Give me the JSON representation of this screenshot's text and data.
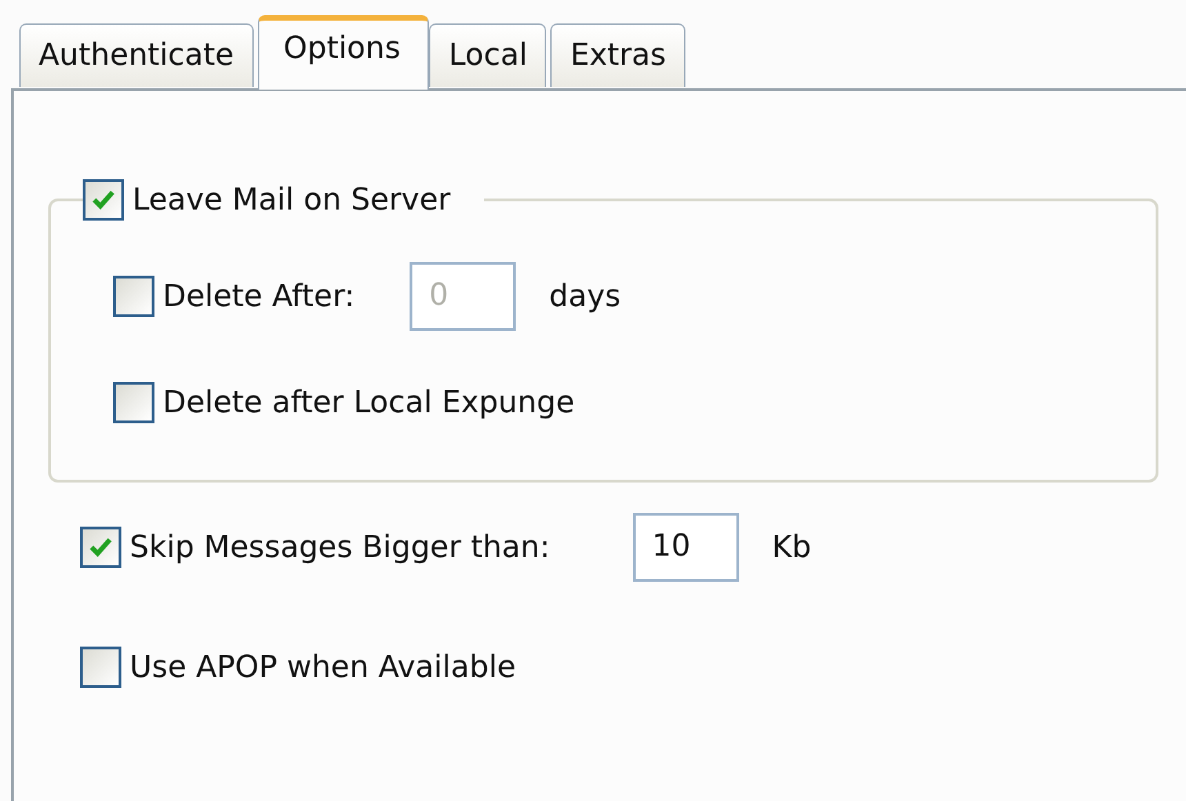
{
  "tabs": [
    {
      "label": "Authenticate",
      "selected": false
    },
    {
      "label": "Options",
      "selected": true
    },
    {
      "label": "Local",
      "selected": false
    },
    {
      "label": "Extras",
      "selected": false
    }
  ],
  "group": {
    "label": "Leave Mail on Server",
    "checked": true,
    "rows": [
      {
        "kind": "checkbox-field",
        "label": "Delete After:",
        "checked": false,
        "field": {
          "value": "0",
          "disabled": true
        },
        "unit": "days"
      },
      {
        "kind": "checkbox",
        "label": "Delete after Local Expunge",
        "checked": false
      }
    ]
  },
  "options": [
    {
      "kind": "checkbox-field",
      "label": "Skip Messages Bigger than:",
      "checked": true,
      "field": {
        "value": "10",
        "disabled": false
      },
      "unit": "Kb"
    },
    {
      "kind": "checkbox",
      "label": "Use APOP when Available",
      "checked": false
    }
  ]
}
